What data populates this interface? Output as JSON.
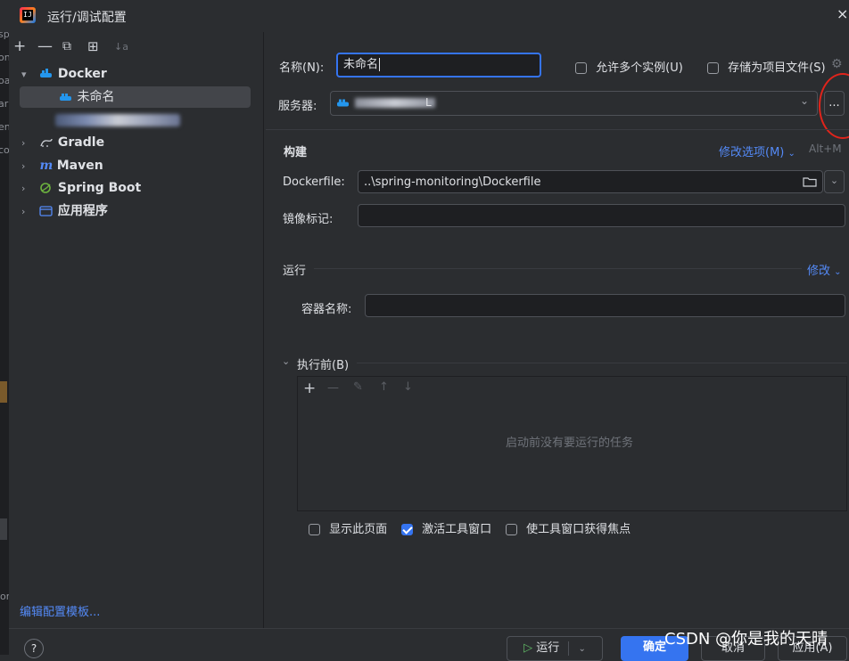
{
  "window": {
    "title": "运行/调试配置",
    "close_glyph": "×"
  },
  "leftstrip": {
    "fragments": [
      "D",
      "sp",
      "on",
      "oa",
      "ar",
      "en",
      "co"
    ],
    "bottom_fragment": "or"
  },
  "sidebar": {
    "toolbar": [
      "+",
      "—",
      "⧉",
      "⊞",
      "↓a"
    ],
    "tree": [
      {
        "label": "Docker",
        "expanded": true,
        "icon": "docker-icon"
      },
      {
        "label": "未命名",
        "selected": true,
        "icon": "docker-icon"
      },
      {
        "label": "Gradle",
        "expanded": false,
        "icon": "gradle-icon"
      },
      {
        "label": "Maven",
        "expanded": false,
        "icon": "maven-icon",
        "icon_glyph": "m"
      },
      {
        "label": "Spring Boot",
        "expanded": false,
        "icon": "spring-boot-icon"
      },
      {
        "label": "应用程序",
        "expanded": false,
        "icon": "application-icon"
      }
    ],
    "edit_templates": "编辑配置模板..."
  },
  "form": {
    "name_label": "名称(N):",
    "name_value": "未命名",
    "allow_multiple": {
      "label": "允许多个实例(U)",
      "checked": false
    },
    "store_as_project_file": {
      "label": "存储为项目文件(S)",
      "checked": false
    },
    "server_label": "服务器:",
    "server_value": "L",
    "server_more_button": "...",
    "build": {
      "title": "构建",
      "modify_options": "修改选项(M)",
      "shortcut": "Alt+M",
      "dockerfile_label": "Dockerfile:",
      "dockerfile_value": "..\\spring-monitoring\\Dockerfile",
      "image_tag_label": "镜像标记:",
      "image_tag_value": ""
    },
    "run": {
      "title": "运行",
      "modify": "修改",
      "container_name_label": "容器名称:",
      "container_name_value": ""
    },
    "before_launch": {
      "title": "执行前(B)",
      "toolbar": [
        "+",
        "—",
        "✎",
        "↑",
        "↓"
      ],
      "empty_text": "启动前没有要运行的任务"
    },
    "options": [
      {
        "label": "显示此页面",
        "checked": false
      },
      {
        "label": "激活工具窗口",
        "checked": true
      },
      {
        "label": "使工具窗口获得焦点",
        "checked": false
      }
    ]
  },
  "footer": {
    "help": "?",
    "run_button": "运行",
    "ok_button": "确定",
    "cancel_button": "取消",
    "apply_button": "应用(A)"
  },
  "watermark": "CSDN @你是我的天晴",
  "colors": {
    "accent": "#3574f0",
    "link": "#548af7",
    "annotation": "#e0241b",
    "docker": "#2496ed",
    "spring": "#6db33f"
  }
}
